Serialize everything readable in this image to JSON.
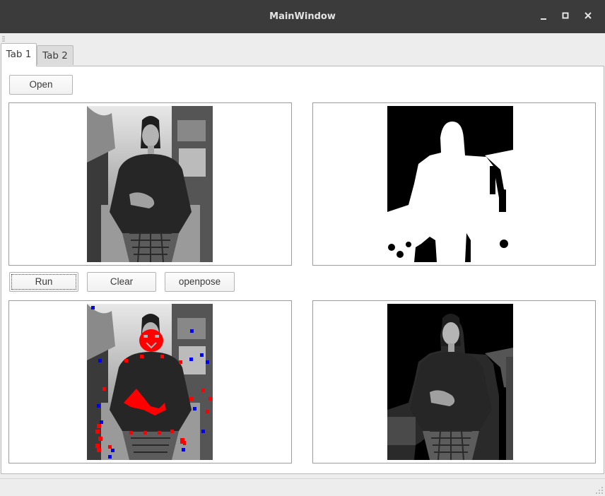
{
  "window": {
    "title": "MainWindow"
  },
  "tabs": [
    {
      "label": "Tab 1",
      "active": true
    },
    {
      "label": "Tab 2",
      "active": false
    }
  ],
  "buttons": {
    "open": "Open",
    "run": "Run",
    "clear": "Clear",
    "openpose": "openpose"
  },
  "images": {
    "original": "grayscale-portrait",
    "mask": "binary-segmentation-mask",
    "keypoints": "portrait-with-keypoints",
    "masked": "masked-portrait"
  },
  "colors": {
    "titlebar": "#3b3b3b",
    "keypoint_red": "#ff0000",
    "keypoint_blue": "#0000ff"
  }
}
